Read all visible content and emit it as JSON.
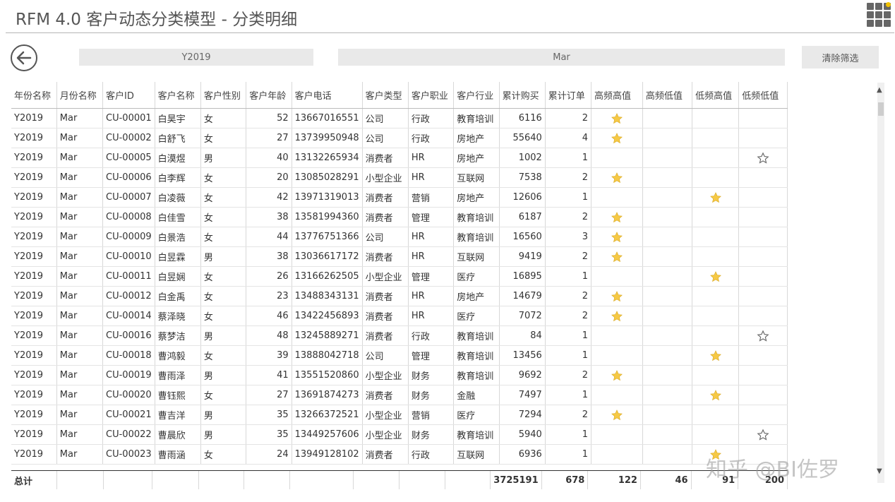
{
  "title": "RFM 4.0 客户动态分类模型 - 分类明细",
  "filters": {
    "year": "Y2019",
    "month": "Mar",
    "clear_label": "清除筛选"
  },
  "colors": {
    "star_fill": "#f6c945",
    "star_outline": "#666666"
  },
  "table": {
    "headers": [
      "年份名称",
      "月份名称",
      "客户ID",
      "客户名称",
      "客户性别",
      "客户年龄",
      "客户电话",
      "客户类型",
      "客户职业",
      "客户行业",
      "累计购买",
      "累计订单",
      "高频高值",
      "高频低值",
      "低频高值",
      "低频低值"
    ],
    "rows": [
      [
        "Y2019",
        "Mar",
        "CU-00001",
        "白昊宇",
        "女",
        "52",
        "13667016551",
        "公司",
        "行政",
        "教育培训",
        "6116",
        "2",
        "hh"
      ],
      [
        "Y2019",
        "Mar",
        "CU-00002",
        "白舒飞",
        "女",
        "27",
        "13739950948",
        "公司",
        "行政",
        "房地产",
        "55640",
        "4",
        "hh"
      ],
      [
        "Y2019",
        "Mar",
        "CU-00005",
        "白漠煜",
        "男",
        "40",
        "13132265934",
        "消费者",
        "HR",
        "房地产",
        "1002",
        "1",
        "ll"
      ],
      [
        "Y2019",
        "Mar",
        "CU-00006",
        "白李辉",
        "女",
        "20",
        "13085028291",
        "小型企业",
        "HR",
        "互联网",
        "7538",
        "2",
        "hh"
      ],
      [
        "Y2019",
        "Mar",
        "CU-00007",
        "白凌薇",
        "女",
        "42",
        "13971319013",
        "消费者",
        "营销",
        "房地产",
        "12606",
        "1",
        "lh"
      ],
      [
        "Y2019",
        "Mar",
        "CU-00008",
        "白佳雪",
        "女",
        "38",
        "13581994360",
        "消费者",
        "管理",
        "教育培训",
        "6187",
        "2",
        "hh"
      ],
      [
        "Y2019",
        "Mar",
        "CU-00009",
        "白景浩",
        "女",
        "44",
        "13776751366",
        "公司",
        "HR",
        "教育培训",
        "16560",
        "3",
        "hh"
      ],
      [
        "Y2019",
        "Mar",
        "CU-00010",
        "白昱霖",
        "男",
        "38",
        "13036617172",
        "消费者",
        "HR",
        "互联网",
        "9419",
        "2",
        "hh"
      ],
      [
        "Y2019",
        "Mar",
        "CU-00011",
        "白昱娴",
        "女",
        "26",
        "13166262505",
        "小型企业",
        "管理",
        "医疗",
        "16895",
        "1",
        "lh"
      ],
      [
        "Y2019",
        "Mar",
        "CU-00012",
        "白金禹",
        "女",
        "23",
        "13488343131",
        "消费者",
        "HR",
        "房地产",
        "14679",
        "2",
        "hh"
      ],
      [
        "Y2019",
        "Mar",
        "CU-00014",
        "蔡泽晓",
        "女",
        "46",
        "13422456893",
        "消费者",
        "HR",
        "医疗",
        "7072",
        "2",
        "hh"
      ],
      [
        "Y2019",
        "Mar",
        "CU-00016",
        "蔡梦洁",
        "男",
        "48",
        "13245889271",
        "消费者",
        "行政",
        "教育培训",
        "84",
        "1",
        "ll"
      ],
      [
        "Y2019",
        "Mar",
        "CU-00018",
        "曹鸿毅",
        "女",
        "39",
        "13888042718",
        "公司",
        "管理",
        "教育培训",
        "13456",
        "1",
        "lh"
      ],
      [
        "Y2019",
        "Mar",
        "CU-00019",
        "曹雨泽",
        "男",
        "41",
        "13551520860",
        "小型企业",
        "财务",
        "教育培训",
        "9692",
        "2",
        "hh"
      ],
      [
        "Y2019",
        "Mar",
        "CU-00020",
        "曹钰熙",
        "女",
        "27",
        "13691874273",
        "消费者",
        "财务",
        "金融",
        "7497",
        "1",
        "lh"
      ],
      [
        "Y2019",
        "Mar",
        "CU-00021",
        "曹吉洋",
        "男",
        "35",
        "13266372521",
        "小型企业",
        "营销",
        "医疗",
        "7294",
        "2",
        "hh"
      ],
      [
        "Y2019",
        "Mar",
        "CU-00022",
        "曹晨欣",
        "男",
        "35",
        "13449257606",
        "小型企业",
        "财务",
        "教育培训",
        "5940",
        "1",
        "ll"
      ],
      [
        "Y2019",
        "Mar",
        "CU-00023",
        "曹雨涵",
        "女",
        "24",
        "13949128102",
        "消费者",
        "行政",
        "互联网",
        "6936",
        "1",
        "lh"
      ]
    ],
    "totals": {
      "label": "总计",
      "purchase": "3725191",
      "orders": "678",
      "hh": "122",
      "hl": "46",
      "lh": "91",
      "ll": "200"
    }
  },
  "watermark": "知乎 @BI佐罗"
}
